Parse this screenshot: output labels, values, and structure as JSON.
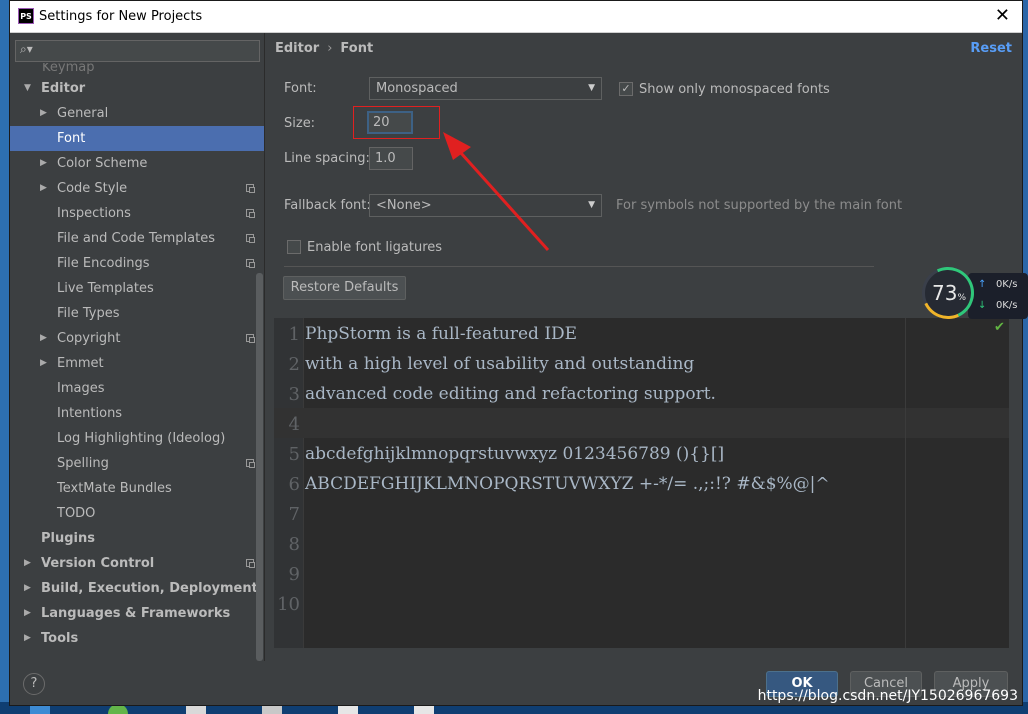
{
  "window": {
    "title": "Settings for New Projects",
    "app_icon": "PS"
  },
  "search": {
    "placeholder": "",
    "value": ""
  },
  "sidebar": {
    "partial_item": "Keymap",
    "items": [
      {
        "label": "Editor",
        "level": 0,
        "bold": true,
        "expanded": true,
        "arrow": "down"
      },
      {
        "label": "General",
        "level": 1,
        "arrow": "right"
      },
      {
        "label": "Font",
        "level": 1,
        "selected": true
      },
      {
        "label": "Color Scheme",
        "level": 1,
        "arrow": "right"
      },
      {
        "label": "Code Style",
        "level": 1,
        "arrow": "right",
        "copy_icon": true
      },
      {
        "label": "Inspections",
        "level": 1,
        "copy_icon": true
      },
      {
        "label": "File and Code Templates",
        "level": 1,
        "copy_icon": true
      },
      {
        "label": "File Encodings",
        "level": 1,
        "copy_icon": true
      },
      {
        "label": "Live Templates",
        "level": 1
      },
      {
        "label": "File Types",
        "level": 1
      },
      {
        "label": "Copyright",
        "level": 1,
        "arrow": "right",
        "copy_icon": true
      },
      {
        "label": "Emmet",
        "level": 1,
        "arrow": "right"
      },
      {
        "label": "Images",
        "level": 1
      },
      {
        "label": "Intentions",
        "level": 1
      },
      {
        "label": "Log Highlighting (Ideolog)",
        "level": 1
      },
      {
        "label": "Spelling",
        "level": 1,
        "copy_icon": true
      },
      {
        "label": "TextMate Bundles",
        "level": 1
      },
      {
        "label": "TODO",
        "level": 1
      },
      {
        "label": "Plugins",
        "level": 0,
        "bold": true
      },
      {
        "label": "Version Control",
        "level": 0,
        "bold": true,
        "arrow": "right",
        "copy_icon": true
      },
      {
        "label": "Build, Execution, Deployment",
        "level": 0,
        "bold": true,
        "arrow": "right"
      },
      {
        "label": "Languages & Frameworks",
        "level": 0,
        "bold": true,
        "arrow": "right"
      },
      {
        "label": "Tools",
        "level": 0,
        "bold": true,
        "arrow": "right"
      }
    ]
  },
  "breadcrumb": {
    "parent": "Editor",
    "separator": "›",
    "current": "Font"
  },
  "reset_label": "Reset",
  "form": {
    "font_label": "Font:",
    "font_value": "Monospaced",
    "show_mono_label": "Show only monospaced fonts",
    "show_mono_checked": true,
    "size_label": "Size:",
    "size_value": "20",
    "line_spacing_label": "Line spacing:",
    "line_spacing_value": "1.0",
    "fallback_label": "Fallback font:",
    "fallback_value": "<None>",
    "fallback_hint": "For symbols not supported by the main font",
    "ligatures_label": "Enable font ligatures",
    "ligatures_checked": false,
    "restore_label": "Restore Defaults"
  },
  "preview": {
    "lines": [
      {
        "num": "1",
        "text": "PhpStorm is a full-featured IDE"
      },
      {
        "num": "2",
        "text": "with a high level of usability and outstanding"
      },
      {
        "num": "3",
        "text": "advanced code editing and refactoring support."
      },
      {
        "num": "4",
        "text": ""
      },
      {
        "num": "5",
        "text": "abcdefghijklmnopqrstuvwxyz 0123456789 (){}[]"
      },
      {
        "num": "6",
        "text": "ABCDEFGHIJKLMNOPQRSTUVWXYZ +-*/= .,;:!? #&$%@|^"
      },
      {
        "num": "7",
        "text": ""
      },
      {
        "num": "8",
        "text": ""
      },
      {
        "num": "9",
        "text": ""
      },
      {
        "num": "10",
        "text": ""
      }
    ]
  },
  "footer": {
    "help": "?",
    "ok": "OK",
    "cancel": "Cancel",
    "apply": "Apply"
  },
  "net_monitor": {
    "percent": "73",
    "percent_sign": "%",
    "up": "0K/s",
    "down": "0K/s"
  },
  "watermark": "https://blog.csdn.net/JY15026967693",
  "colors": {
    "accent": "#4b6eaf",
    "link": "#589df6",
    "annotation": "#e02020"
  }
}
